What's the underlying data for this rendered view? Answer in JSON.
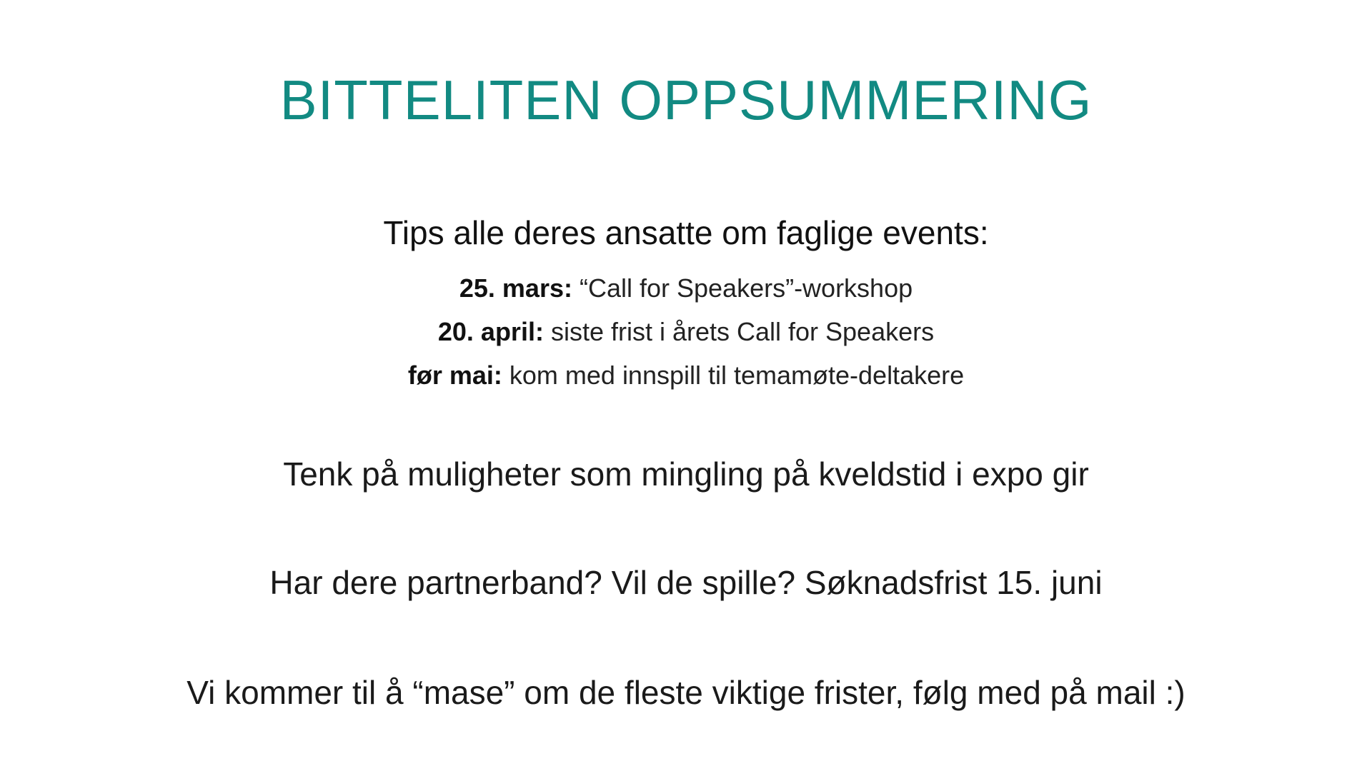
{
  "slide": {
    "title": "BITTELITEN OPPSUMMERING",
    "title_color": "#128a82",
    "tips": {
      "heading": "Tips alle deres ansatte om faglige events:",
      "items": [
        {
          "date": "25. mars:",
          "text": " “Call for Speakers”-workshop"
        },
        {
          "date": "20. april:",
          "text": " siste frist i årets Call for Speakers"
        },
        {
          "date": "før mai:",
          "text": " kom med innspill til temamøte-deltakere"
        }
      ]
    },
    "statements": [
      "Tenk på muligheter som mingling på kveldstid i expo gir",
      "Har dere partnerband? Vil de spille? Søknadsfrist 15. juni",
      "Vi kommer til å “mase” om de fleste viktige frister, følg med på mail :)"
    ]
  }
}
